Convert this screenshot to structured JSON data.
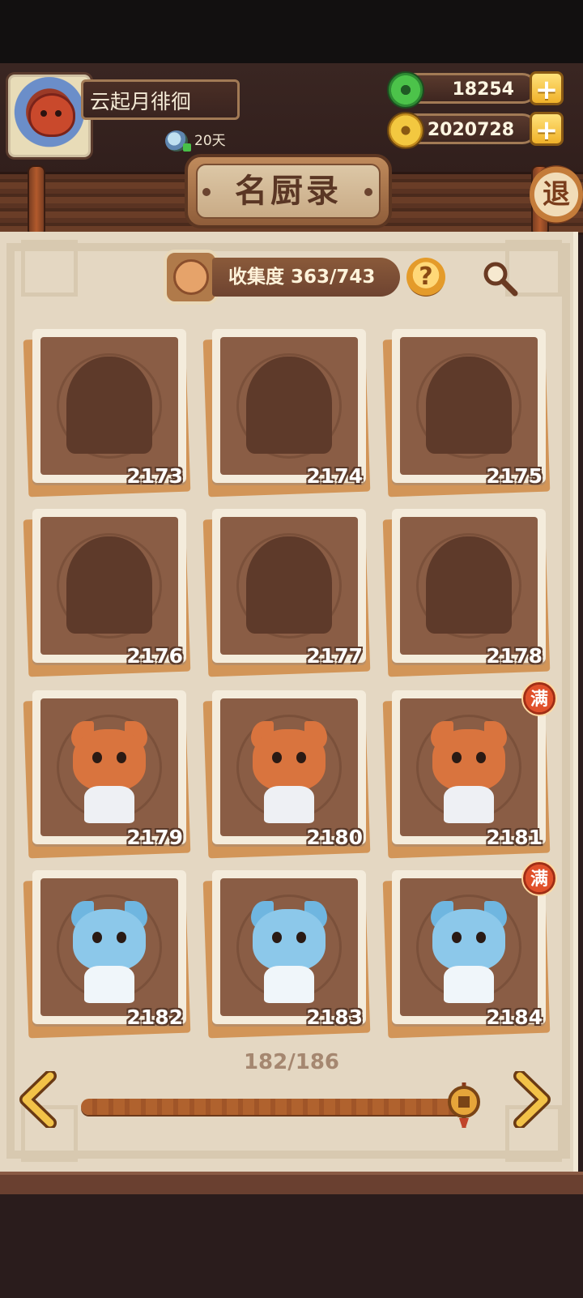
{
  "player": {
    "name": "云起月徘徊",
    "days": "20天"
  },
  "currency": {
    "jade": "18254",
    "coins": "2020728"
  },
  "header": {
    "title": "名厨录",
    "exit_label": "退"
  },
  "collection": {
    "label": "收集度",
    "progress": "363/743",
    "help_label": "?"
  },
  "cards": [
    {
      "id": "2173",
      "state": "locked",
      "full": false
    },
    {
      "id": "2174",
      "state": "locked",
      "full": false
    },
    {
      "id": "2175",
      "state": "locked",
      "full": false
    },
    {
      "id": "2176",
      "state": "locked",
      "full": false
    },
    {
      "id": "2177",
      "state": "locked",
      "full": false
    },
    {
      "id": "2178",
      "state": "locked",
      "full": false
    },
    {
      "id": "2179",
      "state": "cat",
      "full": false
    },
    {
      "id": "2180",
      "state": "cat",
      "full": false
    },
    {
      "id": "2181",
      "state": "cat",
      "full": true
    },
    {
      "id": "2182",
      "state": "bunny",
      "full": false
    },
    {
      "id": "2183",
      "state": "bunny",
      "full": false
    },
    {
      "id": "2184",
      "state": "bunny",
      "full": true
    }
  ],
  "full_badge": "满",
  "pagination": {
    "current": "182/186",
    "position": 0.978
  },
  "icons": {
    "plus": "plus-icon",
    "search": "search-icon",
    "prev": "chevron-left-icon",
    "next": "chevron-right-icon"
  },
  "colors": {
    "panel": "#e4d7c2",
    "card_bg": "#8a5d45",
    "accent": "#f0b22a"
  }
}
